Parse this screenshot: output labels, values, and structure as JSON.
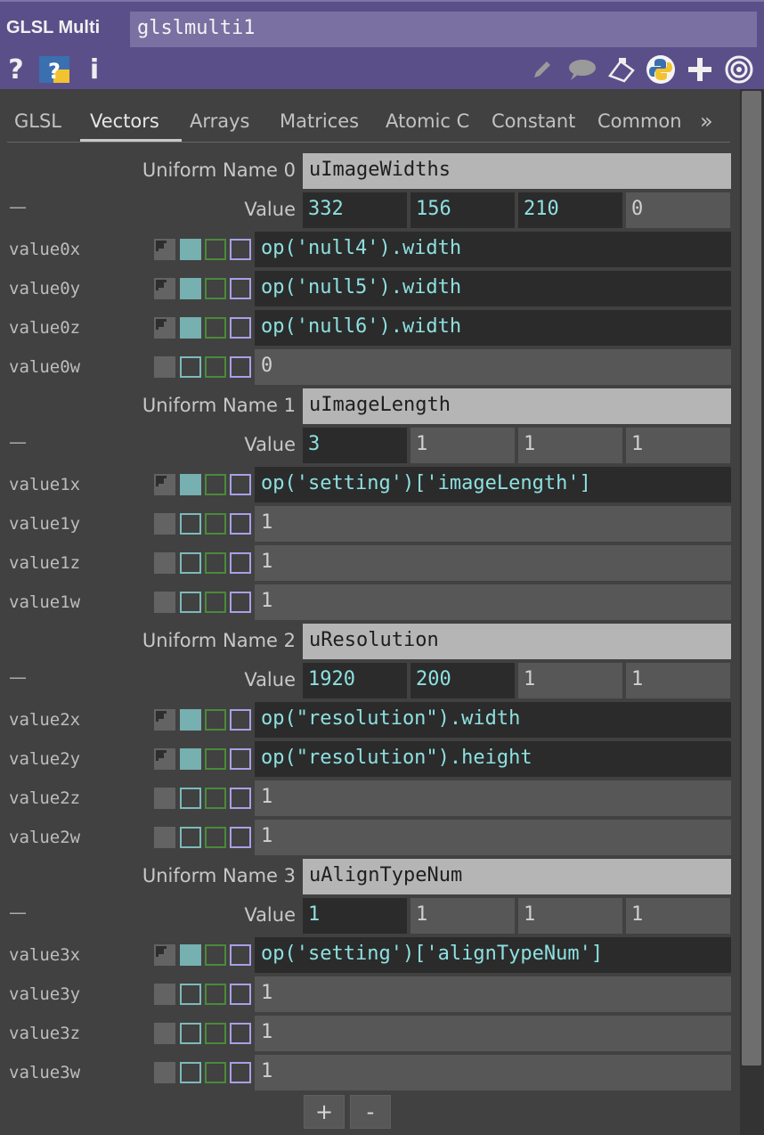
{
  "header": {
    "op_type": "GLSL Multi",
    "op_name": "glslmulti1",
    "help_glyph": "?",
    "info_glyph": "i"
  },
  "tabs": [
    {
      "label": "GLSL"
    },
    {
      "label": "Vectors"
    },
    {
      "label": "Arrays"
    },
    {
      "label": "Matrices"
    },
    {
      "label": "Atomic C"
    },
    {
      "label": "Constant"
    },
    {
      "label": "Common"
    }
  ],
  "active_tab": "Vectors",
  "tab_more_glyph": "»",
  "uniforms": [
    {
      "name_label": "Uniform Name 0",
      "name": "uImageWidths",
      "value_label": "Value",
      "dash": "—",
      "values": [
        "332",
        "156",
        "210",
        "0"
      ],
      "components": [
        {
          "label": "value0x",
          "text": "op('null4').width",
          "mode": "expression"
        },
        {
          "label": "value0y",
          "text": "op('null5').width",
          "mode": "expression"
        },
        {
          "label": "value0z",
          "text": "op('null6').width",
          "mode": "expression"
        },
        {
          "label": "value0w",
          "text": "0",
          "mode": "constant"
        }
      ]
    },
    {
      "name_label": "Uniform Name 1",
      "name": "uImageLength",
      "value_label": "Value",
      "dash": "—",
      "values": [
        "3",
        "1",
        "1",
        "1"
      ],
      "components": [
        {
          "label": "value1x",
          "text": "op('setting')['imageLength']",
          "mode": "expression"
        },
        {
          "label": "value1y",
          "text": "1",
          "mode": "constant"
        },
        {
          "label": "value1z",
          "text": "1",
          "mode": "constant"
        },
        {
          "label": "value1w",
          "text": "1",
          "mode": "constant"
        }
      ]
    },
    {
      "name_label": "Uniform Name 2",
      "name": "uResolution",
      "value_label": "Value",
      "dash": "—",
      "values": [
        "1920",
        "200",
        "1",
        "1"
      ],
      "components": [
        {
          "label": "value2x",
          "text": "op(\"resolution\").width",
          "mode": "expression"
        },
        {
          "label": "value2y",
          "text": "op(\"resolution\").height",
          "mode": "expression"
        },
        {
          "label": "value2z",
          "text": "1",
          "mode": "constant"
        },
        {
          "label": "value2w",
          "text": "1",
          "mode": "constant"
        }
      ]
    },
    {
      "name_label": "Uniform Name 3",
      "name": "uAlignTypeNum",
      "value_label": "Value",
      "dash": "—",
      "values": [
        "1",
        "1",
        "1",
        "1"
      ],
      "components": [
        {
          "label": "value3x",
          "text": "op('setting')['alignTypeNum']",
          "mode": "expression"
        },
        {
          "label": "value3y",
          "text": "1",
          "mode": "constant"
        },
        {
          "label": "value3z",
          "text": "1",
          "mode": "constant"
        },
        {
          "label": "value3w",
          "text": "1",
          "mode": "constant"
        }
      ]
    }
  ],
  "footer": {
    "add_label": "+",
    "remove_label": "-"
  },
  "colors": {
    "header_bg": "#5b4f8a",
    "expression_text": "#8ee0e0",
    "expression_mode": "#76b0b0",
    "export_mode": "#4b8a39",
    "bind_mode": "#a8a0e6"
  }
}
